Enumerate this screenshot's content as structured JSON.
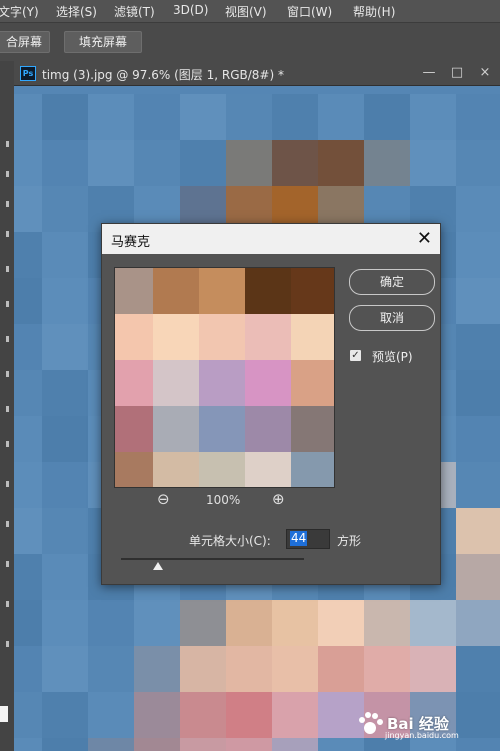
{
  "menubar": {
    "items": [
      "文字(Y)",
      "选择(S)",
      "滤镜(T)",
      "3D(D)",
      "视图(V)",
      "窗口(W)",
      "帮助(H)"
    ]
  },
  "options_bar": {
    "left_button": "合屏幕",
    "fill_screen_button": "填充屏幕"
  },
  "document": {
    "app_badge": "Ps",
    "tab_title": "timg (3).jpg @ 97.6% (图层 1, RGB/8#) *",
    "minimize": "—",
    "restore": "□",
    "close": "×"
  },
  "dialog": {
    "title": "马赛克",
    "close": "✕",
    "ok_label": "确定",
    "cancel_label": "取消",
    "preview_checked": "✓",
    "preview_label": "预览(P)",
    "zoom_out": "⊖",
    "zoom_level": "100%",
    "zoom_in": "⊕",
    "cell_size_label": "单元格大小(C):",
    "cell_size_value": "44",
    "cell_unit": "方形",
    "slider_value": 0.2
  },
  "watermark": {
    "text": "Bai 经验",
    "sub": "jingyan.baidu.com"
  },
  "colors": {
    "canvas_bg": "#5586b4",
    "dialog_bg": "#535353",
    "selection": "#1e6fd9"
  }
}
